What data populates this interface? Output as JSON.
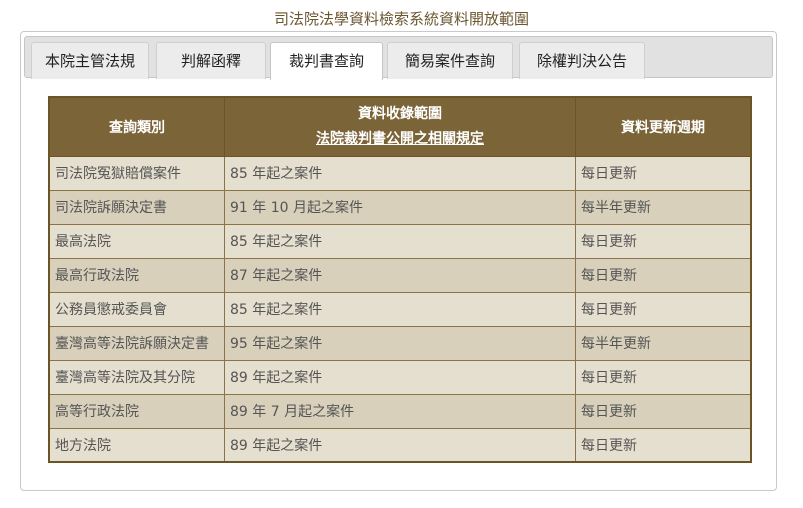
{
  "page": {
    "title": "司法院法學資料檢索系統資料開放範圍"
  },
  "tabs": [
    {
      "label": "本院主管法規"
    },
    {
      "label": "判解函釋"
    },
    {
      "label": "裁判書查詢"
    },
    {
      "label": "簡易案件查詢"
    },
    {
      "label": "除權判決公告"
    }
  ],
  "active_tab": "裁判書查詢",
  "table": {
    "headers": {
      "category": "查詢類別",
      "range": "資料收錄範圍",
      "range_link": "法院裁判書公開之相關規定",
      "cycle": "資料更新週期"
    },
    "rows": [
      {
        "category": "司法院冤獄賠償案件",
        "range": "85 年起之案件",
        "cycle": "每日更新"
      },
      {
        "category": "司法院訴願決定書",
        "range": "91 年 10 月起之案件",
        "cycle": "每半年更新"
      },
      {
        "category": "最高法院",
        "range": "85 年起之案件",
        "cycle": "每日更新"
      },
      {
        "category": "最高行政法院",
        "range": "87 年起之案件",
        "cycle": "每日更新"
      },
      {
        "category": "公務員懲戒委員會",
        "range": "85 年起之案件",
        "cycle": "每日更新"
      },
      {
        "category": "臺灣高等法院訴願決定書",
        "range": "95 年起之案件",
        "cycle": "每半年更新"
      },
      {
        "category": "臺灣高等法院及其分院",
        "range": "89 年起之案件",
        "cycle": "每日更新"
      },
      {
        "category": "高等行政法院",
        "range": "89 年 7 月起之案件",
        "cycle": "每日更新"
      },
      {
        "category": "地方法院",
        "range": "89 年起之案件",
        "cycle": "每日更新"
      }
    ]
  },
  "colors": {
    "header_bg": "#7b6438",
    "row_odd": "#e5dfcf",
    "row_even": "#d8d0bb",
    "title_text": "#6b5630"
  }
}
